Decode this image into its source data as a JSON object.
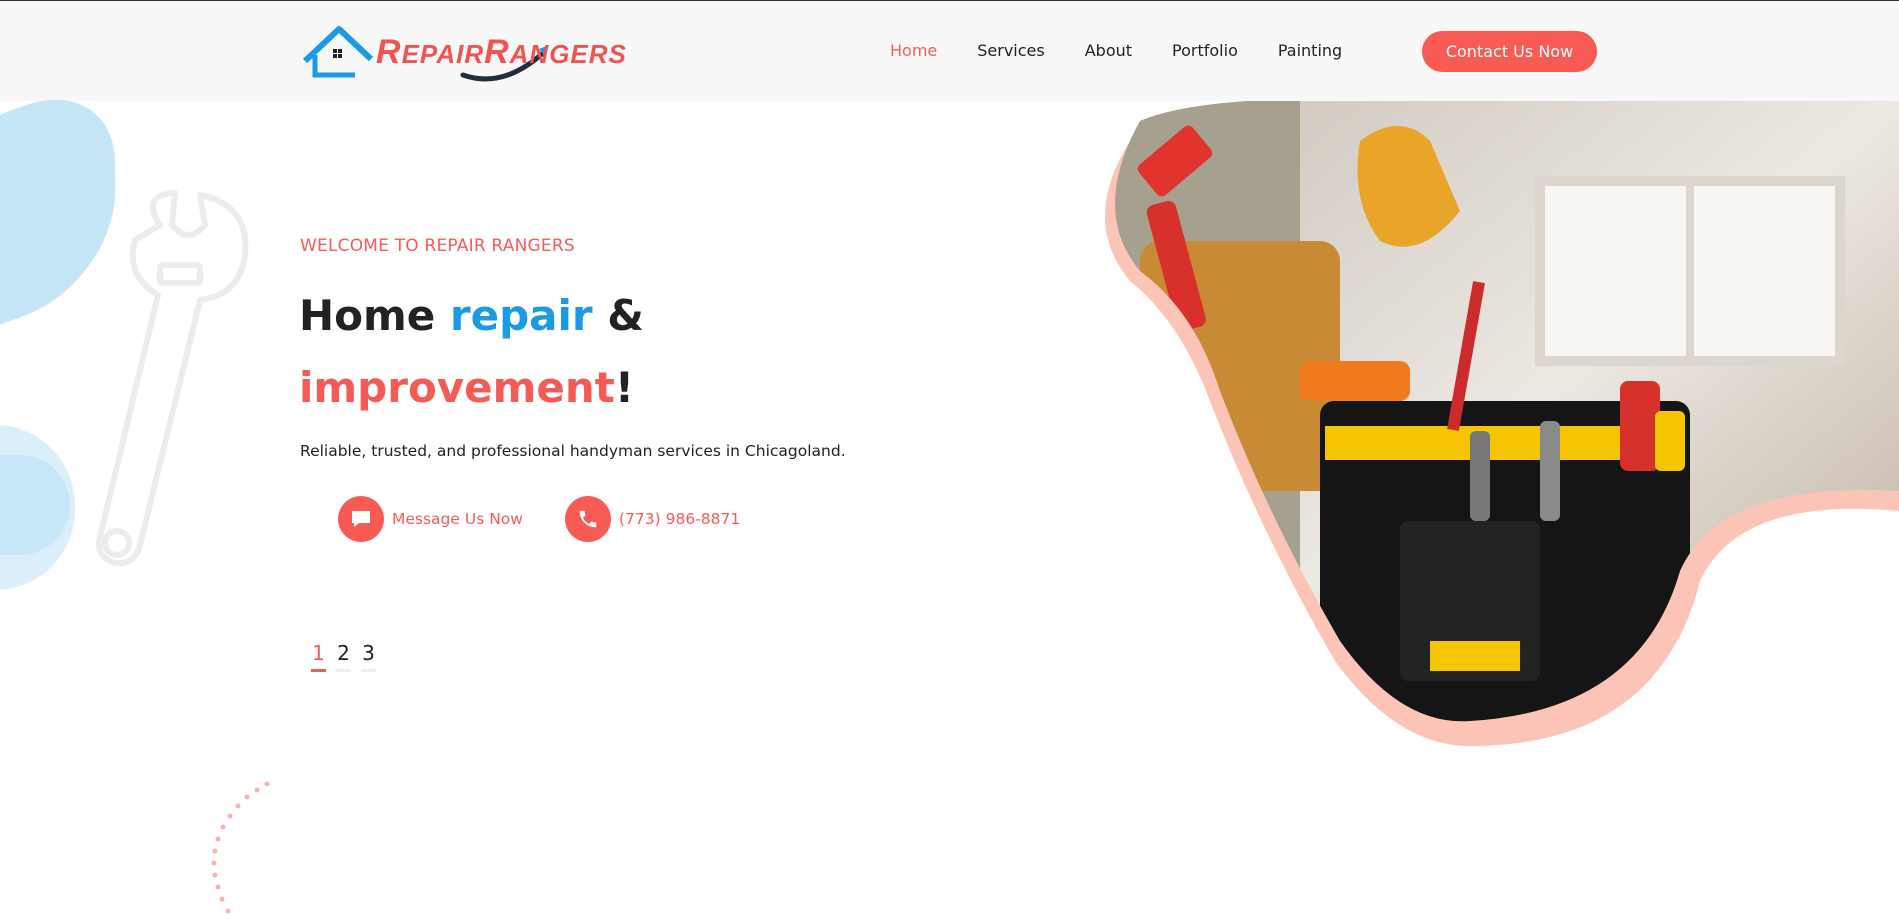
{
  "brand": {
    "logo_text_1": "R",
    "logo_text_2": "EPAIR",
    "logo_text_3": "R",
    "logo_text_4": "ANGERS",
    "logo_alt": "RepairRangers"
  },
  "nav": {
    "items": [
      {
        "label": "Home",
        "active": true
      },
      {
        "label": "Services",
        "active": false
      },
      {
        "label": "About",
        "active": false
      },
      {
        "label": "Portfolio",
        "active": false
      },
      {
        "label": "Painting",
        "active": false
      }
    ],
    "cta_label": "Contact Us Now"
  },
  "hero": {
    "kicker": "WELCOME TO REPAIR RANGERS",
    "headline": {
      "part1": "Home ",
      "part2": "repair",
      "part3": " &",
      "part4": "improvement",
      "part5": "!"
    },
    "subtitle": "Reliable, trusted, and professional handyman services in Chicagoland.",
    "actions": [
      {
        "label": "Message Us Now",
        "icon": "chat-icon"
      },
      {
        "label": "(773) 986-8871",
        "icon": "phone-icon"
      }
    ],
    "pager": [
      {
        "label": "1",
        "active": true
      },
      {
        "label": "2",
        "active": false
      },
      {
        "label": "3",
        "active": false
      }
    ]
  },
  "colors": {
    "accent": "#f85a54",
    "blue": "#1a9be3",
    "header_bg": "#f8f8f8"
  }
}
